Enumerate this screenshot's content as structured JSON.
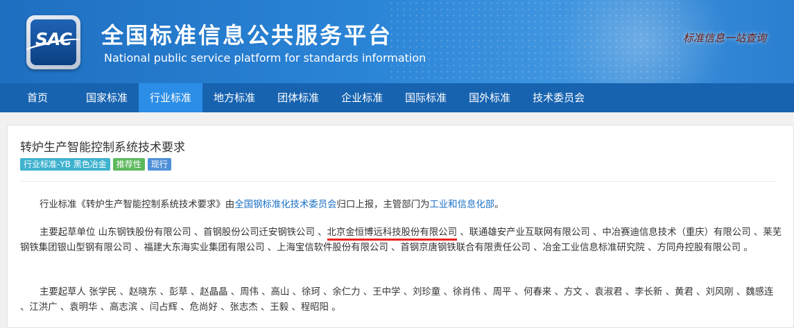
{
  "header": {
    "logo_text": "SAC",
    "title_cn": "全国标准信息公共服务平台",
    "title_en": "National public service platform  for standards information",
    "slogan": "标准信息一站查询"
  },
  "nav": {
    "items": [
      {
        "label": "首页"
      },
      {
        "label": "国家标准"
      },
      {
        "label": "行业标准"
      },
      {
        "label": "地方标准"
      },
      {
        "label": "团体标准"
      },
      {
        "label": "企业标准"
      },
      {
        "label": "国际标准"
      },
      {
        "label": "国外标准"
      },
      {
        "label": "技术委员会"
      }
    ],
    "active": "行业标准"
  },
  "standard": {
    "title": "转炉生产智能控制系统技术要求",
    "badges": {
      "industry": "行业标准-YB 黑色冶金",
      "nature": "推荐性",
      "status": "现行"
    }
  },
  "intro": {
    "prefix": "行业标准《转炉生产智能控制系统技术要求》由",
    "committee": "全国钢标准化技术委员会",
    "middle": "归口上报，主管部门为",
    "department": "工业和信息化部",
    "suffix": "。"
  },
  "drafting_units": {
    "before": "主要起草单位 山东钢铁股份有限公司 、首钢股份公司迁安钢铁公司 、",
    "highlighted": "北京金恒博远科技股份有限公司",
    "after": " 、联通雄安产业互联网有限公司 、中冶赛迪信息技术（重庆）有限公司 、莱芜钢铁集团银山型钢有限公司 、福建大东海实业集团有限公司 、上海宝信软件股份有限公司 、首钢京唐钢铁联合有限责任公司 、冶金工业信息标准研究院 、方同舟控股有限公司 。"
  },
  "drafters": {
    "text": "主要起草人 张学民 、赵晓东 、彭草 、赵晶晶 、周伟 、高山 、徐珂 、余仁力 、王中学 、刘珍童 、徐肖伟 、周平 、何春来 、方文 、袁淑君 、李长新 、黄君 、刘风刚 、魏感连 、江洪广 、袁明华 、高志滨 、闫占辉 、危尚好 、张志杰 、王毅 、程昭阳 。"
  },
  "colors": {
    "nav_bg": "#1763b0",
    "nav_active": "#2b8de6",
    "link": "#1a6fc4",
    "highlight_underline": "#e8201a"
  }
}
